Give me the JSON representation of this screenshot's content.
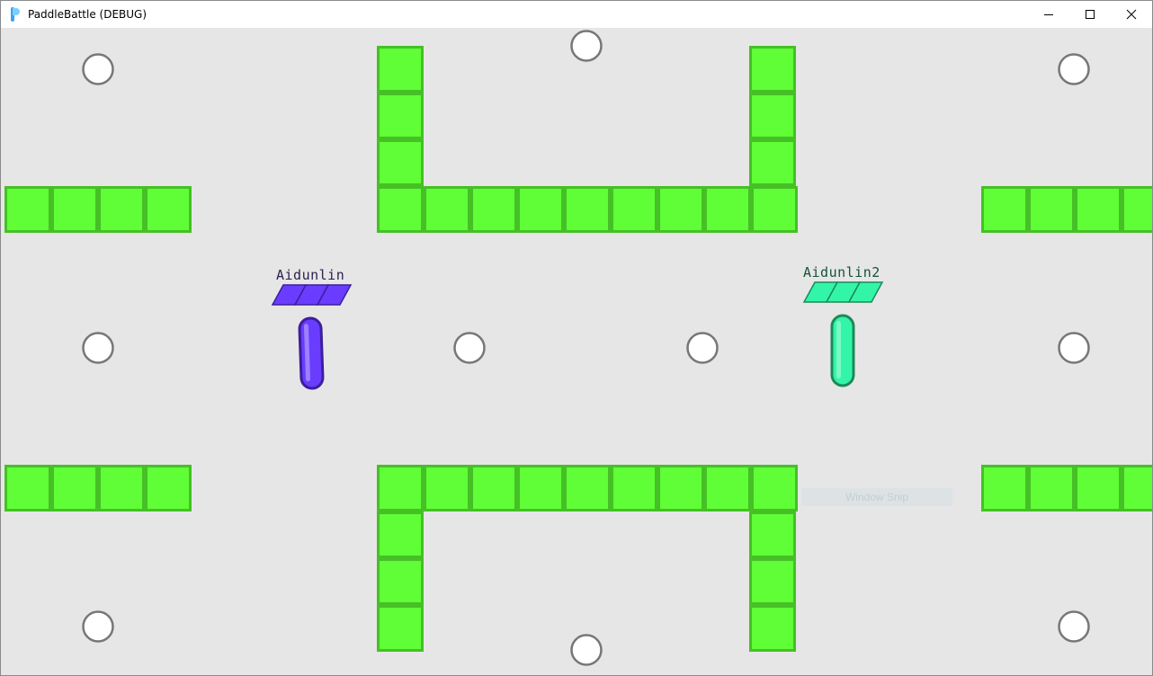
{
  "window": {
    "title": "PaddleBattle (DEBUG)",
    "controls": [
      "minimize-icon",
      "maximize-icon",
      "close-icon"
    ]
  },
  "game": {
    "colors": {
      "background": "#e6e6e6",
      "block_fill": "#5ffe36",
      "block_border": "#46c026",
      "peg_fill": "#ffffff",
      "peg_border": "#777777"
    },
    "players": [
      {
        "name": "Aidunlin",
        "color": "#6a3cff",
        "border": "#3a1f9e",
        "text_color": "#2b1f4e",
        "health_segments": 3
      },
      {
        "name": "Aidunlin2",
        "color": "#33f5a8",
        "border": "#1b8a5a",
        "text_color": "#15523b",
        "health_segments": 3
      }
    ]
  },
  "overlay": {
    "snip_label": "Window Snip"
  }
}
